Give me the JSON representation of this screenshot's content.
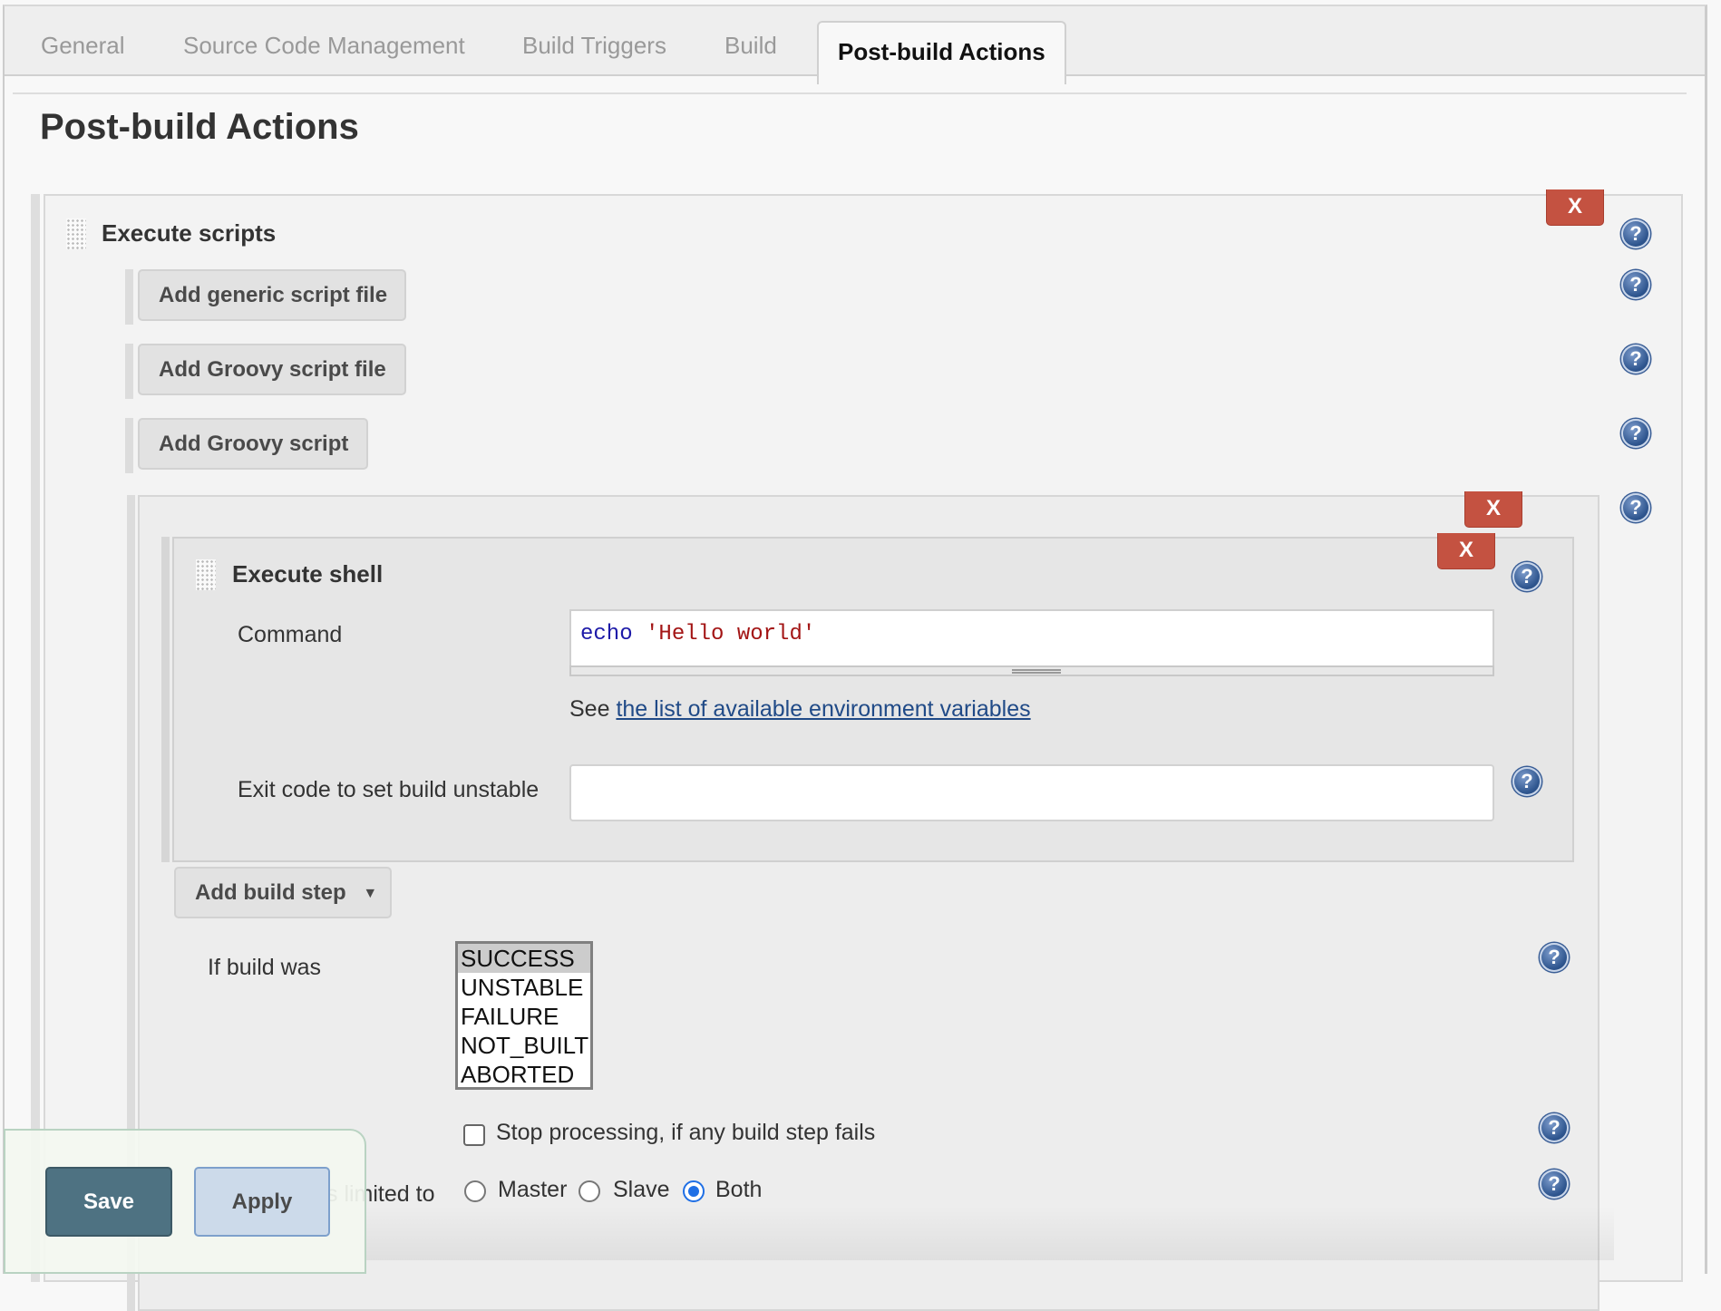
{
  "tabs": [
    {
      "label": "General",
      "active": false
    },
    {
      "label": "Source Code Management",
      "active": false
    },
    {
      "label": "Build Triggers",
      "active": false
    },
    {
      "label": "Build",
      "active": false
    },
    {
      "label": "Post-build Actions",
      "active": true
    }
  ],
  "page_title": "Post-build Actions",
  "execute_scripts": {
    "heading": "Execute scripts",
    "delete_label": "X",
    "add_buttons": [
      {
        "label": "Add generic script file"
      },
      {
        "label": "Add Groovy script file"
      },
      {
        "label": "Add Groovy script"
      }
    ],
    "groovy_block": {
      "delete_label": "X",
      "execute_shell": {
        "heading": "Execute shell",
        "delete_label": "X",
        "command_label": "Command",
        "command_keyword": "echo",
        "command_string": "'Hello world'",
        "hint_prefix": "See",
        "hint_link": "the list of available environment variables",
        "exit_code_label": "Exit code to set build unstable",
        "exit_code_value": ""
      },
      "add_build_step_label": "Add build step",
      "if_build_was_label": "If build was",
      "build_results": [
        "SUCCESS",
        "UNSTABLE",
        "FAILURE",
        "NOT_BUILT",
        "ABORTED"
      ],
      "selected_result": "SUCCESS",
      "stop_processing_label": "Stop processing, if any build step fails",
      "stop_processing_checked": false,
      "limited_to_label": "Execution is limited to",
      "limited_to_visible_fragment": "s limited to",
      "limited_to_options": [
        "Master",
        "Slave",
        "Both"
      ],
      "limited_to_selected": "Both"
    }
  },
  "footer": {
    "save_label": "Save",
    "apply_label": "Apply"
  },
  "colors": {
    "delete_button": "#c45241",
    "save_button": "#4e7282",
    "apply_button": "#ccdaea",
    "link": "#204a87",
    "radio_selected": "#1f6fe5"
  }
}
